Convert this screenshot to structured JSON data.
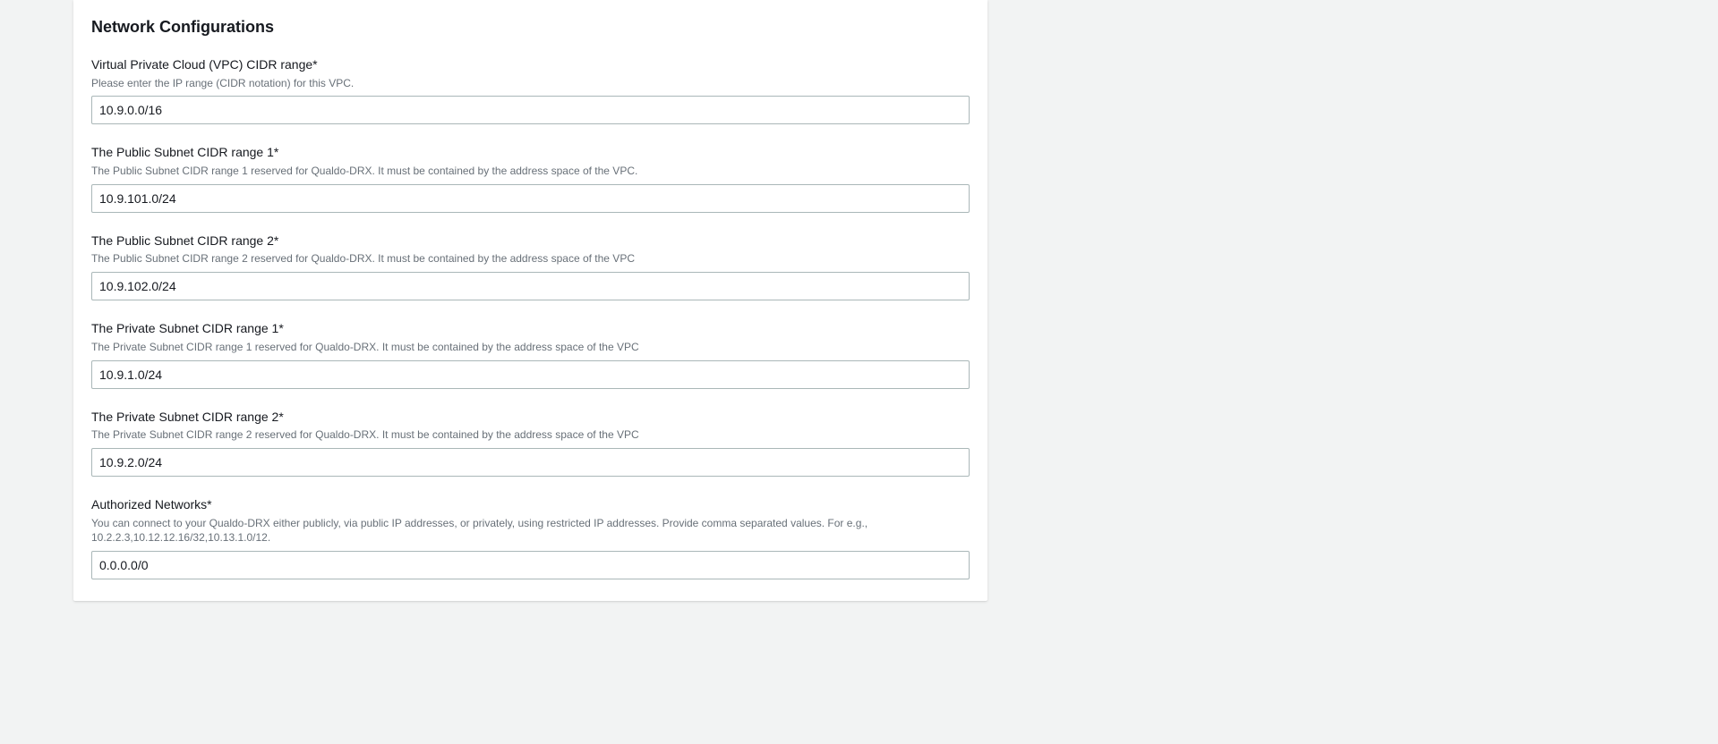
{
  "section_title": "Network Configurations",
  "fields": {
    "vpc_cidr": {
      "label": "Virtual Private Cloud (VPC) CIDR range*",
      "desc": "Please enter the IP range (CIDR notation) for this VPC.",
      "value": "10.9.0.0/16"
    },
    "public_subnet_1": {
      "label": "The Public Subnet CIDR range 1*",
      "desc": "The Public Subnet CIDR range 1 reserved for Qualdo-DRX. It must be contained by the address space of the VPC.",
      "value": "10.9.101.0/24"
    },
    "public_subnet_2": {
      "label": "The Public Subnet CIDR range 2*",
      "desc": "The Public Subnet CIDR range 2 reserved for Qualdo-DRX. It must be contained by the address space of the VPC",
      "value": "10.9.102.0/24"
    },
    "private_subnet_1": {
      "label": "The Private Subnet CIDR range 1*",
      "desc": "The Private Subnet CIDR range 1 reserved for Qualdo-DRX. It must be contained by the address space of the VPC",
      "value": "10.9.1.0/24"
    },
    "private_subnet_2": {
      "label": "The Private Subnet CIDR range 2*",
      "desc": "The Private Subnet CIDR range 2 reserved for Qualdo-DRX. It must be contained by the address space of the VPC",
      "value": "10.9.2.0/24"
    },
    "authorized_networks": {
      "label": "Authorized Networks*",
      "desc": "You can connect to your Qualdo-DRX either publicly, via public IP addresses, or privately, using restricted IP addresses. Provide comma separated values. For e.g., 10.2.2.3,10.12.12.16/32,10.13.1.0/12.",
      "value": "0.0.0.0/0"
    }
  }
}
